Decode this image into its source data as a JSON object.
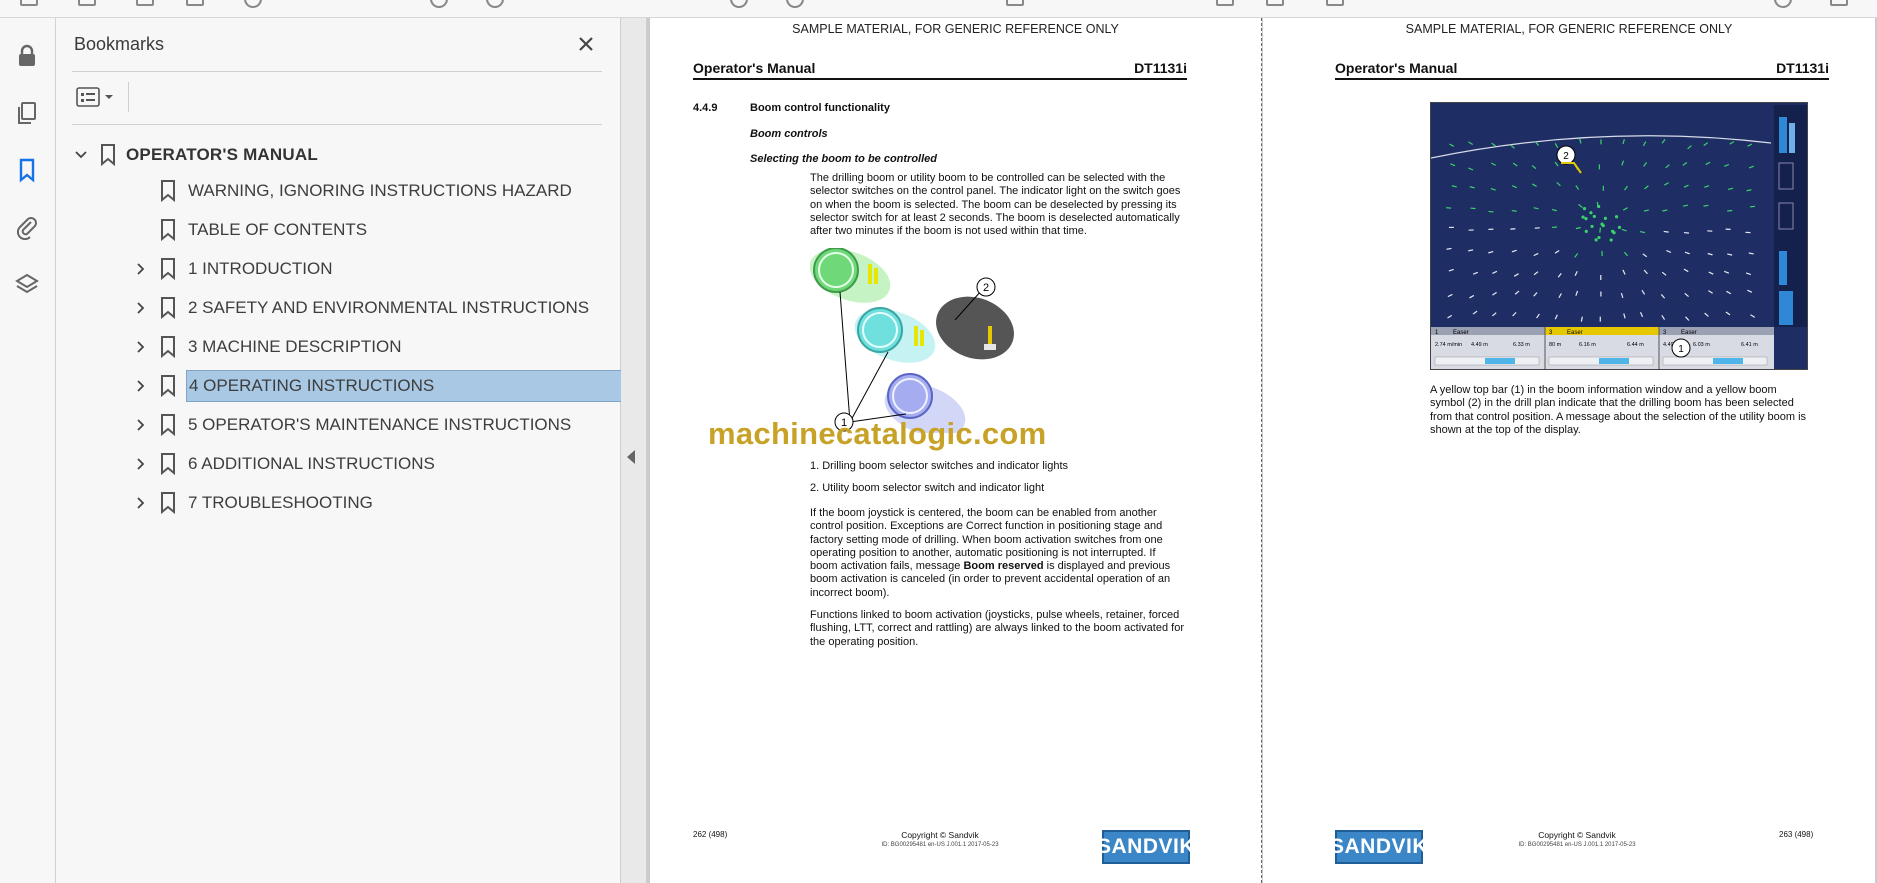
{
  "bookmarks_panel": {
    "title": "Bookmarks",
    "root": {
      "label": "OPERATOR'S MANUAL"
    },
    "items": [
      {
        "label": "WARNING, IGNORING INSTRUCTIONS HAZARD",
        "expandable": false
      },
      {
        "label": "TABLE OF CONTENTS",
        "expandable": false
      },
      {
        "label": "1 INTRODUCTION",
        "expandable": true
      },
      {
        "label": "2 SAFETY AND ENVIRONMENTAL INSTRUCTIONS",
        "expandable": true
      },
      {
        "label": "3 MACHINE DESCRIPTION",
        "expandable": true
      },
      {
        "label": "4 OPERATING INSTRUCTIONS",
        "expandable": true,
        "selected": true
      },
      {
        "label": "5 OPERATOR'S MAINTENANCE INSTRUCTIONS",
        "expandable": true
      },
      {
        "label": "6 ADDITIONAL INSTRUCTIONS",
        "expandable": true
      },
      {
        "label": "7 TROUBLESHOOTING",
        "expandable": true
      }
    ],
    "selected_color": "#a8c8e4"
  },
  "left_page": {
    "sample_notice": "SAMPLE MATERIAL, FOR GENERIC REFERENCE ONLY",
    "header_title": "Operator's Manual",
    "header_model": "DT1131i",
    "section_number": "4.4.9",
    "section_title": "Boom control functionality",
    "subheading1": "Boom controls",
    "subheading2": "Selecting the boom to be controlled",
    "para1": "The drilling boom or utility boom to be controlled can be selected with the selector switches on the control panel. The indicator light on the switch goes on when the boom is selected. The boom can be deselected by pressing its selector switch for at least 2 seconds. The boom is deselected automatically after two minutes if the boom is not used within that time.",
    "callout_1": "1",
    "callout_2": "2",
    "legend1": "1. Drilling boom selector switches and indicator lights",
    "legend2": "2. Utility boom selector switch and indicator light",
    "para2_a": "If the boom joystick is centered, the boom can be enabled from another control position. Exceptions are Correct function in positioning stage and factory setting mode of drilling. When boom activation switches from one operating position to another, automatic positioning is not interrupted. If boom activation fails, message ",
    "para2_bold": "Boom reserved",
    "para2_b": " is displayed and previous boom activation is canceled (in order to prevent accidental operation of an incorrect boom).",
    "para3": "Functions linked to boom activation (joysticks, pulse wheels, retainer, forced flushing, LTT, correct and rattling) are always linked to the boom activated for the operating position.",
    "page_number": "262 (498)",
    "copyright": "Copyright © Sandvik",
    "doc_id": "ID: BG00295481 en-US J.001.1 2017-05-23",
    "logo_text": "SANDVIK"
  },
  "watermark": "machinecatalogic.com",
  "right_page": {
    "sample_notice": "SAMPLE MATERIAL, FOR GENERIC REFERENCE ONLY",
    "header_title": "Operator's Manual",
    "header_model": "DT1131i",
    "screen_callout_1": "1",
    "screen_callout_2": "2",
    "boom_tabs": [
      {
        "number": "1",
        "name": "Easer",
        "readout_a": "2.74 m/min",
        "readout_b": "4.49 m",
        "readout_c": "6.33 m"
      },
      {
        "number": "3",
        "name": "Easer",
        "readout_a": "80 m",
        "readout_b": "6.16 m",
        "readout_c": "6.44 m"
      },
      {
        "number": "3",
        "name": "Easer",
        "readout_a": "4.49 m",
        "readout_b": "6.03 m",
        "readout_c": "6.41 m"
      }
    ],
    "caption": "A yellow top bar (1) in the boom information window and a yellow boom symbol (2) in the drill plan indicate that the drilling boom has been selected from that control position. A message about the selection of the utility boom is shown at the top of the display.",
    "page_number": "263 (498)",
    "copyright": "Copyright © Sandvik",
    "doc_id": "ID: BG00295481 en-US J.001.1 2017-05-23",
    "logo_text": "SANDVIK"
  }
}
